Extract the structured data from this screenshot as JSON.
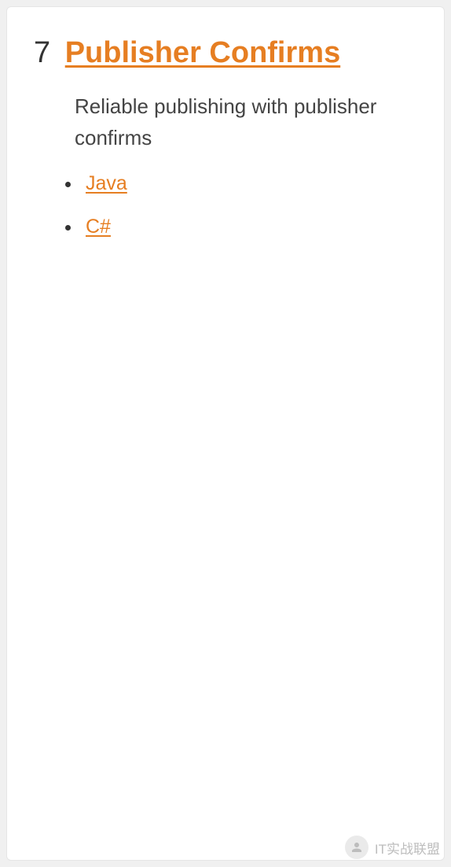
{
  "section": {
    "number": "7",
    "title": "Publisher Confirms",
    "description": "Reliable publishing with publisher confirms"
  },
  "languages": [
    {
      "label": "Java"
    },
    {
      "label": "C#"
    }
  ],
  "watermark": {
    "text": "IT实战联盟"
  }
}
